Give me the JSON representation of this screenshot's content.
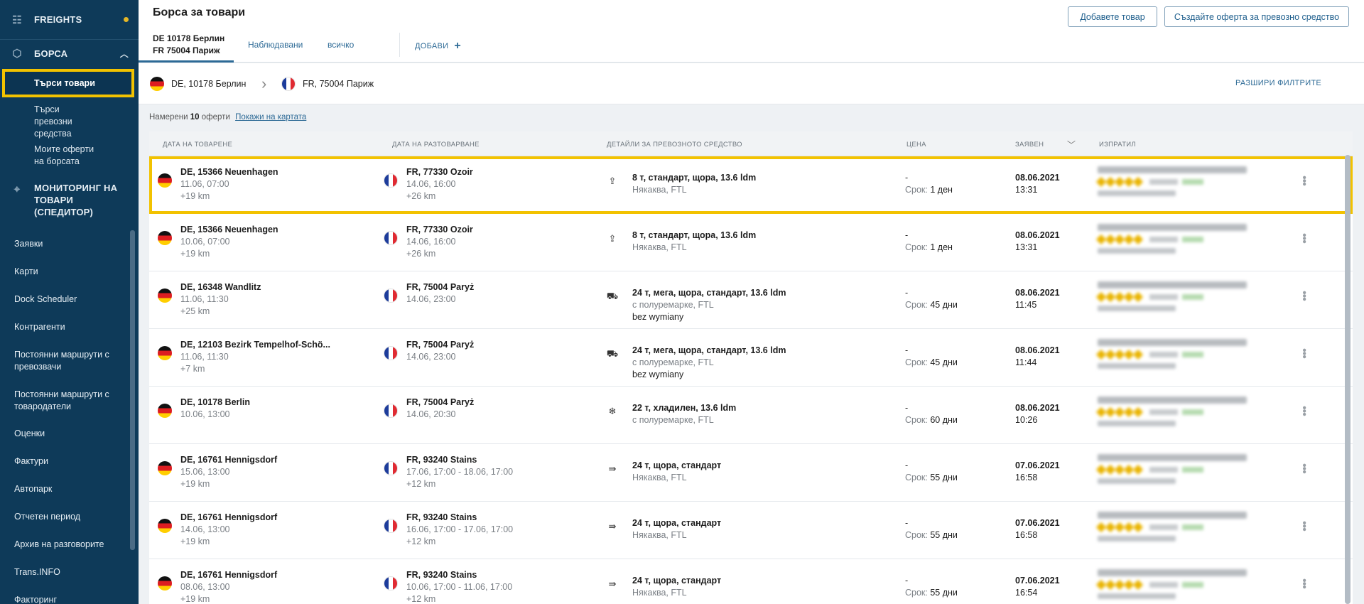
{
  "sidebar": {
    "freights": "FREIGHTS",
    "borsa": "БОРСА",
    "sub": [
      "Търси товари",
      "Търси превозни средства",
      "Моите оферти на борсата"
    ],
    "monitoring": "МОНИТОРИНГ НА ТОВАРИ (СПЕДИТОР)",
    "items": [
      "Заявки",
      "Карти",
      "Dock Scheduler",
      "Контрагенти",
      "Постоянни маршрути с превозвачи",
      "Постоянни маршрути с товародатели",
      "Оценки",
      "Фактури",
      "Автопарк",
      "Отчетен период",
      "Архив на разговорите",
      "Trans.INFO",
      "Факторинг"
    ]
  },
  "header": {
    "title": "Борса за товари",
    "btn_add": "Добавете товар",
    "btn_offer": "Създайте оферта за превозно средство",
    "tab_route_1": "DE 10178 Берлин",
    "tab_route_2": "FR 75004 Париж",
    "tab_watched": "Наблюдавани",
    "tab_all": "всичко",
    "tab_add": "ДОБАВИ"
  },
  "filter": {
    "from": "DE, 10178 Берлин",
    "to": "FR, 75004 Париж",
    "expand": "РАЗШИРИ ФИЛТРИТЕ"
  },
  "results": {
    "prefix": "Намерени",
    "count": "10",
    "suffix": "оферти",
    "map_link": "Покажи на картата"
  },
  "table": {
    "headers": [
      "ДАТА НА ТОВАРЕНЕ",
      "ДАТА НА РАЗТОВАРВАНЕ",
      "ДЕТАЙЛИ ЗА ПРЕВОЗНОТО СРЕДСТВО",
      "ЦЕНА",
      "ЗАЯВЕН",
      "ИЗПРАТИЛ"
    ],
    "rows": [
      {
        "load_place": "DE, 15366 Neuenhagen",
        "load_date": "11.06, 07:00",
        "load_km": "+19 km",
        "unload_place": "FR, 77330 Ozoir",
        "unload_date": "14.06, 16:00",
        "unload_km": "+26 km",
        "veh_icon": "upload-box-icon",
        "veh_title": "8 т, стандарт, щора, 13.6 ldm",
        "veh_sub": "Някаква, FTL",
        "veh_extra": "",
        "price": "-",
        "term_label": "Срок:",
        "term": "1 ден",
        "date": "08.06.2021",
        "time": "13:31"
      },
      {
        "load_place": "DE, 15366 Neuenhagen",
        "load_date": "10.06, 07:00",
        "load_km": "+19 km",
        "unload_place": "FR, 77330 Ozoir",
        "unload_date": "14.06, 16:00",
        "unload_km": "+26 km",
        "veh_icon": "upload-box-icon",
        "veh_title": "8 т, стандарт, щора, 13.6 ldm",
        "veh_sub": "Някаква, FTL",
        "veh_extra": "",
        "price": "-",
        "term_label": "Срок:",
        "term": "1 ден",
        "date": "08.06.2021",
        "time": "13:31"
      },
      {
        "load_place": "DE, 16348 Wandlitz",
        "load_date": "11.06, 11:30",
        "load_km": "+25 km",
        "unload_place": "FR, 75004 Paryż",
        "unload_date": "14.06, 23:00",
        "unload_km": "",
        "veh_icon": "trailer-icon",
        "veh_title": "24 т, мега, щора, стандарт, 13.6 ldm",
        "veh_sub": "с полуремарке, FTL",
        "veh_extra": "bez wymiany",
        "price": "-",
        "term_label": "Срок:",
        "term": "45 дни",
        "date": "08.06.2021",
        "time": "11:45"
      },
      {
        "load_place": "DE, 12103 Bezirk Tempelhof-Schö...",
        "load_date": "11.06, 11:30",
        "load_km": "+7 km",
        "unload_place": "FR, 75004 Paryż",
        "unload_date": "14.06, 23:00",
        "unload_km": "",
        "veh_icon": "trailer-icon",
        "veh_title": "24 т, мега, щора, стандарт, 13.6 ldm",
        "veh_sub": "с полуремарке, FTL",
        "veh_extra": "bez wymiany",
        "price": "-",
        "term_label": "Срок:",
        "term": "45 дни",
        "date": "08.06.2021",
        "time": "11:44"
      },
      {
        "load_place": "DE, 10178 Berlin",
        "load_date": "10.06, 13:00",
        "load_km": "",
        "unload_place": "FR, 75004 Paryż",
        "unload_date": "14.06, 20:30",
        "unload_km": "",
        "veh_icon": "snowflake-icon",
        "veh_title": "22 т, хладилен, 13.6 ldm",
        "veh_sub": "с полуремарке, FTL",
        "veh_extra": "",
        "price": "-",
        "term_label": "Срок:",
        "term": "60 дни",
        "date": "08.06.2021",
        "time": "10:26"
      },
      {
        "load_place": "DE, 16761 Hennigsdorf",
        "load_date": "15.06, 13:00",
        "load_km": "+19 km",
        "unload_place": "FR, 93240 Stains",
        "unload_date": "17.06, 17:00 - 18.06, 17:00",
        "unload_km": "+12 km",
        "veh_icon": "curtain-icon",
        "veh_title": "24 т, щора, стандарт",
        "veh_sub": "Някаква, FTL",
        "veh_extra": "",
        "price": "-",
        "term_label": "Срок:",
        "term": "55 дни",
        "date": "07.06.2021",
        "time": "16:58"
      },
      {
        "load_place": "DE, 16761 Hennigsdorf",
        "load_date": "14.06, 13:00",
        "load_km": "+19 km",
        "unload_place": "FR, 93240 Stains",
        "unload_date": "16.06, 17:00 - 17.06, 17:00",
        "unload_km": "+12 km",
        "veh_icon": "curtain-icon",
        "veh_title": "24 т, щора, стандарт",
        "veh_sub": "Някаква, FTL",
        "veh_extra": "",
        "price": "-",
        "term_label": "Срок:",
        "term": "55 дни",
        "date": "07.06.2021",
        "time": "16:58"
      },
      {
        "load_place": "DE, 16761 Hennigsdorf",
        "load_date": "08.06, 13:00",
        "load_km": "+19 km",
        "unload_place": "FR, 93240 Stains",
        "unload_date": "10.06, 17:00 - 11.06, 17:00",
        "unload_km": "+12 km",
        "veh_icon": "curtain-icon",
        "veh_title": "24 т, щора, стандарт",
        "veh_sub": "Някаква, FTL",
        "veh_extra": "",
        "price": "-",
        "term_label": "Срок:",
        "term": "55 дни",
        "date": "07.06.2021",
        "time": "16:54"
      }
    ]
  },
  "colors": {
    "sidebar": "#0e3a59",
    "accent": "#2d6a96",
    "highlight": "#f2c200",
    "star": "#e9b400"
  }
}
